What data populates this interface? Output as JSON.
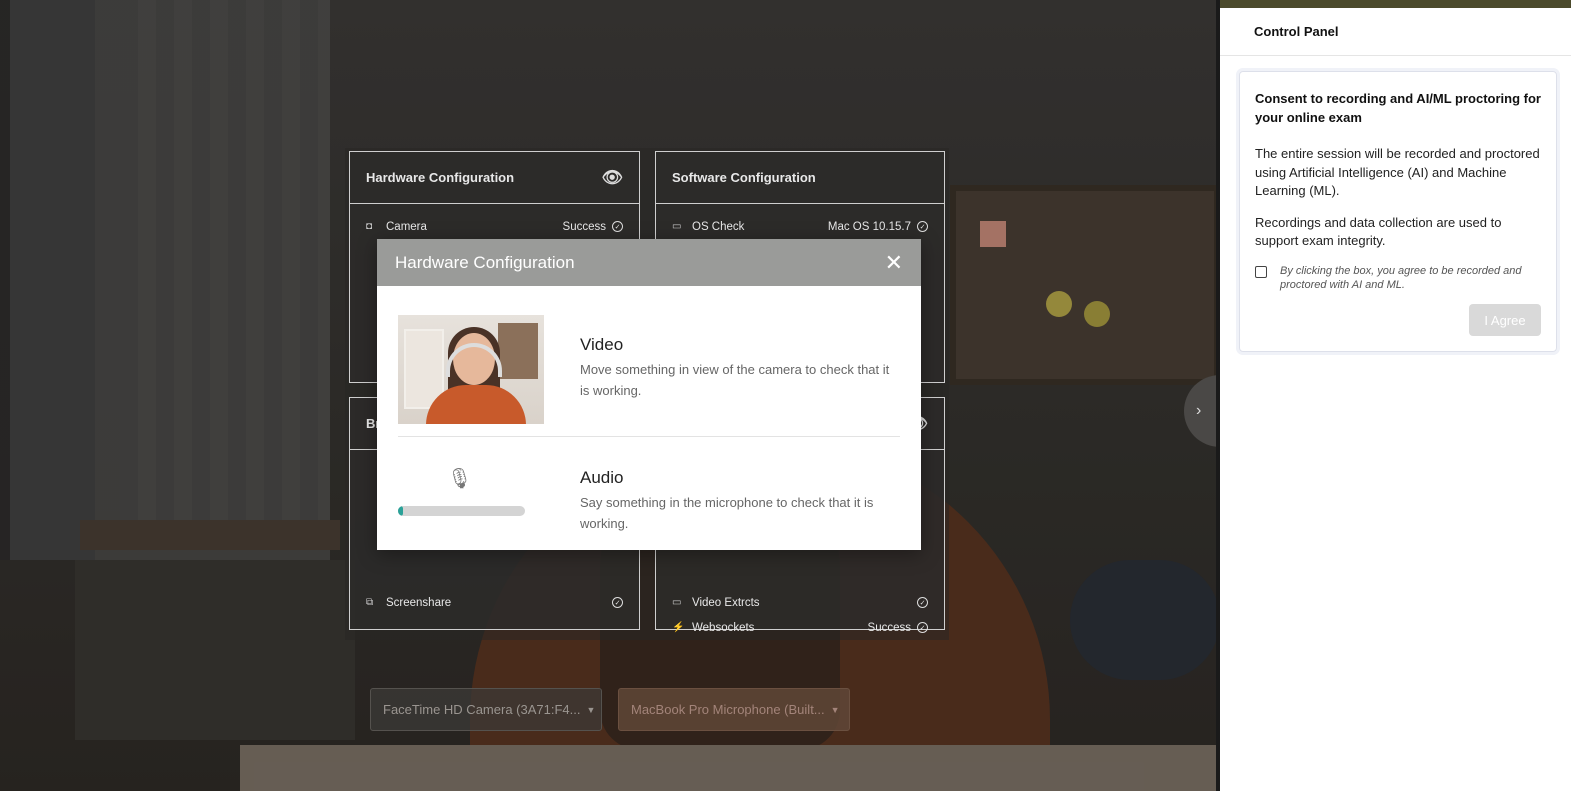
{
  "control_panel": {
    "title": "Control Panel",
    "consent": {
      "heading": "Consent to recording and AI/ML proctoring for your online exam",
      "paragraph1": "The entire session will be recorded and proctored using Artificial Intelligence (AI) and Machine Learning (ML).",
      "paragraph2": "Recordings and data collection are used to support exam integrity.",
      "checkbox_label": "By clicking the box, you agree to be recorded and proctored with AI and ML.",
      "checkbox_checked": false,
      "agree_button": "I Agree"
    }
  },
  "hardware_panel": {
    "title": "Hardware Configuration",
    "rows": [
      {
        "icon": "camera-icon",
        "name": "Camera",
        "status": "Success"
      }
    ]
  },
  "software_panel": {
    "title": "Software Configuration",
    "rows": [
      {
        "icon": "monitor-icon",
        "name": "OS Check",
        "status": "Mac OS 10.15.7"
      }
    ]
  },
  "browser_panel": {
    "title_fragment": "Br",
    "rows": [
      {
        "name": "Screenshare"
      }
    ]
  },
  "network_panel": {
    "rows": [
      {
        "name": "Video Extrcts"
      },
      {
        "name": "Websockets",
        "status": "Success"
      }
    ]
  },
  "modal": {
    "title": "Hardware Configuration",
    "video": {
      "title": "Video",
      "description": "Move something in view of the camera to check that it is working."
    },
    "audio": {
      "title": "Audio",
      "description": "Say something in the microphone to check that it is working.",
      "level_fraction": 0.04
    }
  },
  "device_selects": {
    "camera": "FaceTime HD Camera (3A71:F4...",
    "microphone": "MacBook Pro Microphone (Built..."
  },
  "colors": {
    "modal_header": "#9a9b99",
    "audio_level": "#2aa198",
    "agree_button_disabled": "#d9d9d9"
  }
}
